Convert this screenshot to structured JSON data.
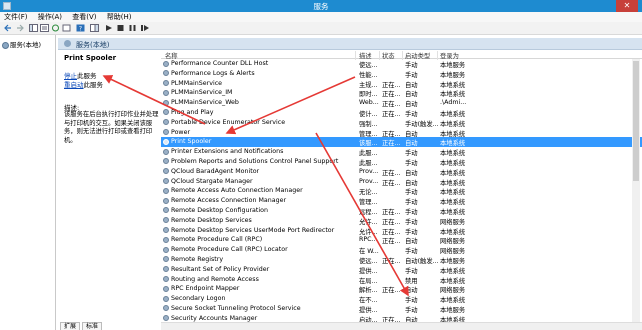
{
  "window": {
    "title": "服务"
  },
  "menu": [
    "文件(F)",
    "操作(A)",
    "查看(V)",
    "帮助(H)"
  ],
  "tree": {
    "root": "服务(本地)"
  },
  "pane": {
    "header": "服务(本地)"
  },
  "details": {
    "service_title": "Print Spooler",
    "stop_link": "停止",
    "stop_suffix": "此服务",
    "restart_link": "重启动",
    "restart_suffix": "此服务",
    "desc_label": "描述:",
    "desc_text": "该服务在后台执行打印作业并处理与打印机的交互。如果关闭该服务，则无法进行打印或查看打印机。"
  },
  "table": {
    "headers": {
      "name": "名称",
      "desc": "描述",
      "status": "状态",
      "startup": "启动类型",
      "logon": "登录为"
    },
    "rows": [
      {
        "name": "Performance Counter DLL Host",
        "desc": "使远...",
        "status": "",
        "startup": "手动",
        "logon": "本地服务"
      },
      {
        "name": "Performance Logs & Alerts",
        "desc": "性能...",
        "status": "",
        "startup": "手动",
        "logon": "本地服务"
      },
      {
        "name": "PLMMainService",
        "desc": "主规...",
        "status": "正在...",
        "startup": "自动",
        "logon": "本地系统"
      },
      {
        "name": "PLMMainService_IM",
        "desc": "即时...",
        "status": "正在...",
        "startup": "自动",
        "logon": "本地系统"
      },
      {
        "name": "PLMMainService_Web",
        "desc": "Web...",
        "status": "正在...",
        "startup": "自动",
        "logon": ".\\Admi..."
      },
      {
        "name": "Plug and Play",
        "desc": "使计...",
        "status": "正在...",
        "startup": "手动",
        "logon": "本地系统"
      },
      {
        "name": "Portable Device Enumerator Service",
        "desc": "强制...",
        "status": "",
        "startup": "手动(触发...",
        "logon": "本地系统"
      },
      {
        "name": "Power",
        "desc": "管理...",
        "status": "正在...",
        "startup": "自动",
        "logon": "本地系统"
      },
      {
        "name": "Print Spooler",
        "desc": "该服...",
        "status": "正在...",
        "startup": "自动",
        "logon": "本地系统"
      },
      {
        "name": "Printer Extensions and Notifications",
        "desc": "此服...",
        "status": "",
        "startup": "手动",
        "logon": "本地系统"
      },
      {
        "name": "Problem Reports and Solutions Control Panel Support",
        "desc": "此服...",
        "status": "",
        "startup": "手动",
        "logon": "本地系统"
      },
      {
        "name": "QCloud BaradAgent Monitor",
        "desc": "Prov...",
        "status": "正在...",
        "startup": "自动",
        "logon": "本地系统"
      },
      {
        "name": "QCloud Stargate Manager",
        "desc": "Prov...",
        "status": "正在...",
        "startup": "自动",
        "logon": "本地系统"
      },
      {
        "name": "Remote Access Auto Connection Manager",
        "desc": "无论...",
        "status": "",
        "startup": "手动",
        "logon": "本地系统"
      },
      {
        "name": "Remote Access Connection Manager",
        "desc": "管理...",
        "status": "",
        "startup": "手动",
        "logon": "本地系统"
      },
      {
        "name": "Remote Desktop Configuration",
        "desc": "远程...",
        "status": "正在...",
        "startup": "手动",
        "logon": "本地系统"
      },
      {
        "name": "Remote Desktop Services",
        "desc": "允许...",
        "status": "正在...",
        "startup": "手动",
        "logon": "网络服务"
      },
      {
        "name": "Remote Desktop Services UserMode Port Redirector",
        "desc": "允许...",
        "status": "正在...",
        "startup": "手动",
        "logon": "本地系统"
      },
      {
        "name": "Remote Procedure Call (RPC)",
        "desc": "RPC...",
        "status": "正在...",
        "startup": "自动",
        "logon": "网络服务"
      },
      {
        "name": "Remote Procedure Call (RPC) Locator",
        "desc": "在 W...",
        "status": "",
        "startup": "手动",
        "logon": "网络服务"
      },
      {
        "name": "Remote Registry",
        "desc": "使远...",
        "status": "正在...",
        "startup": "自动(触发...",
        "logon": "本地服务"
      },
      {
        "name": "Resultant Set of Policy Provider",
        "desc": "提供...",
        "status": "",
        "startup": "手动",
        "logon": "本地系统"
      },
      {
        "name": "Routing and Remote Access",
        "desc": "在局...",
        "status": "",
        "startup": "禁用",
        "logon": "本地系统"
      },
      {
        "name": "RPC Endpoint Mapper",
        "desc": "解析...",
        "status": "正在...",
        "startup": "自动",
        "logon": "网络服务"
      },
      {
        "name": "Secondary Logon",
        "desc": "在不...",
        "status": "",
        "startup": "手动",
        "logon": "本地系统"
      },
      {
        "name": "Secure Socket Tunneling Protocol Service",
        "desc": "提供...",
        "status": "",
        "startup": "手动",
        "logon": "本地服务"
      },
      {
        "name": "Security Accounts Manager",
        "desc": "启动...",
        "status": "正在...",
        "startup": "自动",
        "logon": "本地系统"
      }
    ]
  },
  "tabs": [
    "扩展",
    "标准"
  ],
  "colors": {
    "titlebar": "#1e8bd0",
    "selection": "#3399ff",
    "close": "#c7403a",
    "arrow": "#e53935"
  }
}
